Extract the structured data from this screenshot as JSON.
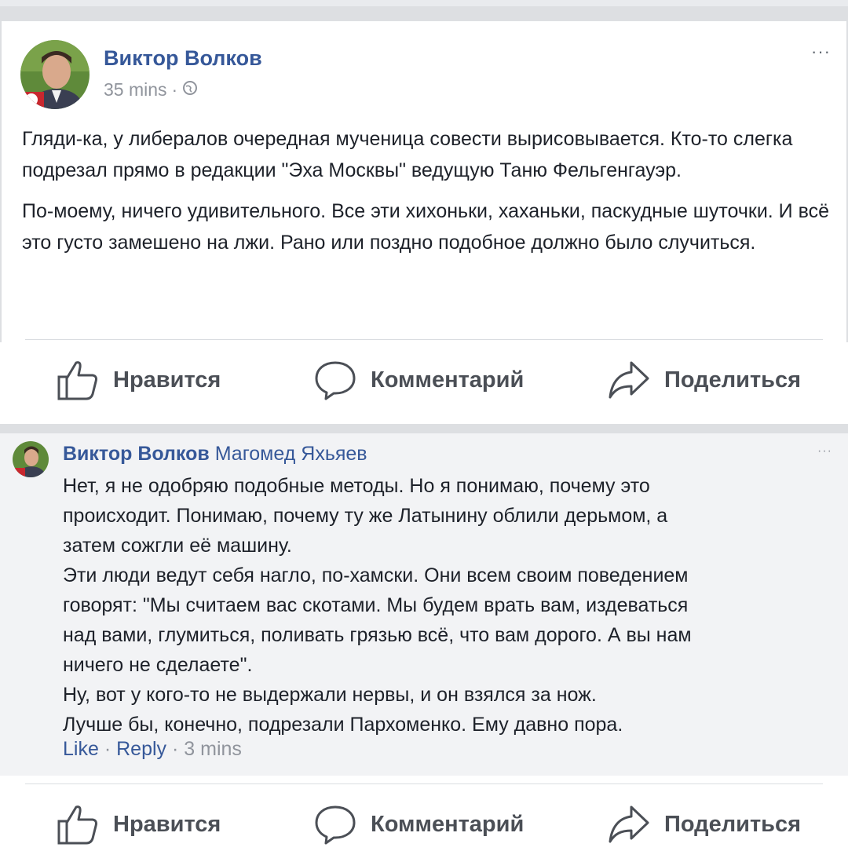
{
  "post": {
    "author": "Виктор Волков",
    "time": "35 mins",
    "separator": "·",
    "more": "···",
    "paragraphs": [
      "Гляди-ка, у либералов очередная мученица совести вырисовывается. Кто-то слегка подрезал прямо в редакции \"Эха Москвы\" ведущую Таню Фельгенгауэр.",
      "По-моему, ничего удивительного. Все эти хихоньки, хаханьки, паскудные шуточки. И всё это густо замешено на лжи. Рано или поздно подобное должно было случиться."
    ]
  },
  "actions": {
    "like": "Нравится",
    "comment": "Комментарий",
    "share": "Поделиться"
  },
  "comment": {
    "author": "Виктор Волков",
    "mention": "Магомед Яхьяев",
    "more": "···",
    "text": [
      "Нет, я не одобряю подобные методы. Но я понимаю, почему это",
      "происходит. Понимаю, почему ту же Латынину облили дерьмом, а",
      "затем сожгли её машину.",
      "Эти люди ведут себя нагло, по-хамски. Они всем своим поведением",
      "говорят: \"Мы считаем вас скотами. Мы будем врать вам, издеваться",
      "над вами, глумиться, поливать грязью всё, что вам дорого. А вы нам",
      "ничего не сделаете\".",
      "Ну, вот у кого-то не выдержали нервы, и он взялся за нож.",
      "Лучше бы, конечно, подрезали Пархоменко. Ему давно пора."
    ],
    "footer": {
      "like": "Like",
      "reply": "Reply",
      "time": "3 mins",
      "separator": "·"
    }
  },
  "colors": {
    "link": "#365899",
    "meta": "#90949c",
    "action": "#4b4f56",
    "comment_bg": "#f2f3f5"
  },
  "icons": [
    "globe-icon",
    "thumbs-up-icon",
    "comment-icon",
    "share-icon",
    "more-icon"
  ]
}
